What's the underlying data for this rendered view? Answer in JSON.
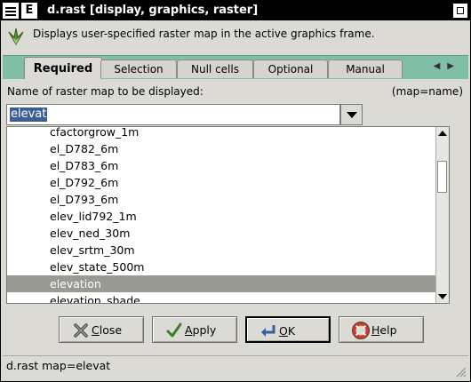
{
  "window": {
    "title": "d.rast [display, graphics, raster]",
    "menu_letter": "E"
  },
  "header": {
    "description": "Displays user-specified raster map in the active graphics frame."
  },
  "tabs": [
    {
      "label": "Required",
      "active": true
    },
    {
      "label": "Selection",
      "active": false
    },
    {
      "label": "Null cells",
      "active": false
    },
    {
      "label": "Optional",
      "active": false
    },
    {
      "label": "Manual",
      "active": false
    }
  ],
  "field": {
    "label": "Name of raster map to be displayed:",
    "param": "(map=name)",
    "value": "elevat"
  },
  "dropdown": {
    "items": [
      "cfactorgrow_1m",
      "el_D782_6m",
      "el_D783_6m",
      "el_D792_6m",
      "el_D793_6m",
      "elev_lid792_1m",
      "elev_ned_30m",
      "elev_srtm_30m",
      "elev_state_500m",
      "elevation",
      "elevation_shade"
    ],
    "selected": "elevation"
  },
  "buttons": {
    "close_first": "C",
    "close_rest": "lose",
    "apply_first": "A",
    "apply_rest": "pply",
    "ok_first": "O",
    "ok_rest": "K",
    "help_first": "H",
    "help_rest": "elp"
  },
  "status": {
    "text": "d.rast map=elevat"
  },
  "colors": {
    "tab_bar": "#7fbfa8",
    "selection": "#3b5f93",
    "list_selected": "#9a9a94"
  }
}
